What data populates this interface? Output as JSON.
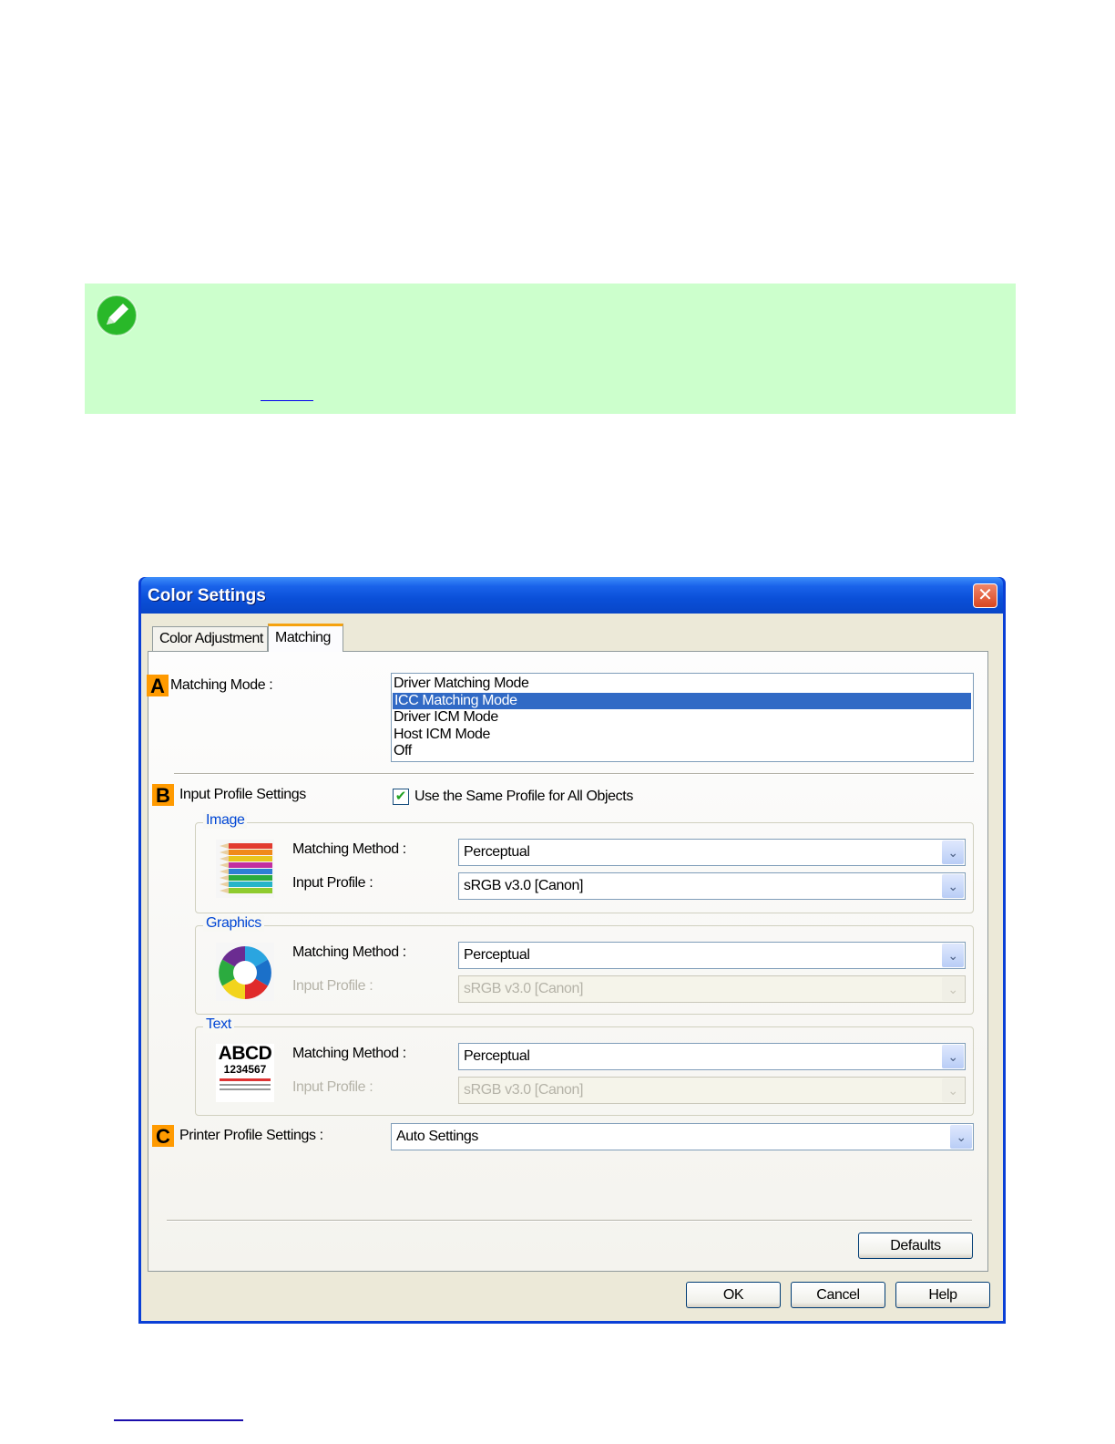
{
  "dialog": {
    "title": "Color Settings",
    "close_symbol": "✕",
    "tabs": [
      {
        "label": "Color Adjustment",
        "active": false
      },
      {
        "label": "Matching",
        "active": true
      }
    ],
    "markers": {
      "a": "A",
      "b": "B",
      "c": "C"
    },
    "matching_mode": {
      "label": "Matching Mode :",
      "options": [
        "Driver Matching Mode",
        "ICC Matching Mode",
        "Driver ICM Mode",
        "Host ICM Mode",
        "Off"
      ],
      "selected": "ICC Matching Mode"
    },
    "input_profile_settings": {
      "label": "Input Profile Settings",
      "same_profile_checkbox": {
        "label": "Use the Same Profile for All Objects",
        "checked": true,
        "check_symbol": "✔"
      }
    },
    "image_group": {
      "title": "Image",
      "matching_method_label": "Matching Method :",
      "matching_method_value": "Perceptual",
      "input_profile_label": "Input Profile :",
      "input_profile_value": "sRGB v3.0 [Canon]"
    },
    "graphics_group": {
      "title": "Graphics",
      "matching_method_label": "Matching Method :",
      "matching_method_value": "Perceptual",
      "input_profile_label": "Input Profile :",
      "input_profile_value": "sRGB v3.0 [Canon]"
    },
    "text_group": {
      "title": "Text",
      "matching_method_label": "Matching Method :",
      "matching_method_value": "Perceptual",
      "input_profile_label": "Input Profile :",
      "input_profile_value": "sRGB v3.0 [Canon]",
      "thumb_line1": "ABCD",
      "thumb_line2": "1234567"
    },
    "printer_profile": {
      "label": "Printer Profile Settings :",
      "value": "Auto Settings"
    },
    "dropdown_symbol": "⌄",
    "buttons": {
      "defaults": "Defaults",
      "ok": "OK",
      "cancel": "Cancel",
      "help": "Help"
    }
  },
  "colors": {
    "note_background": "#ccffcc",
    "titlebar_blue": "#0a4fd8",
    "marker_orange": "#ff9a00",
    "selection_blue": "#316ac5"
  },
  "icons": {
    "note": "pencil-note-icon"
  }
}
